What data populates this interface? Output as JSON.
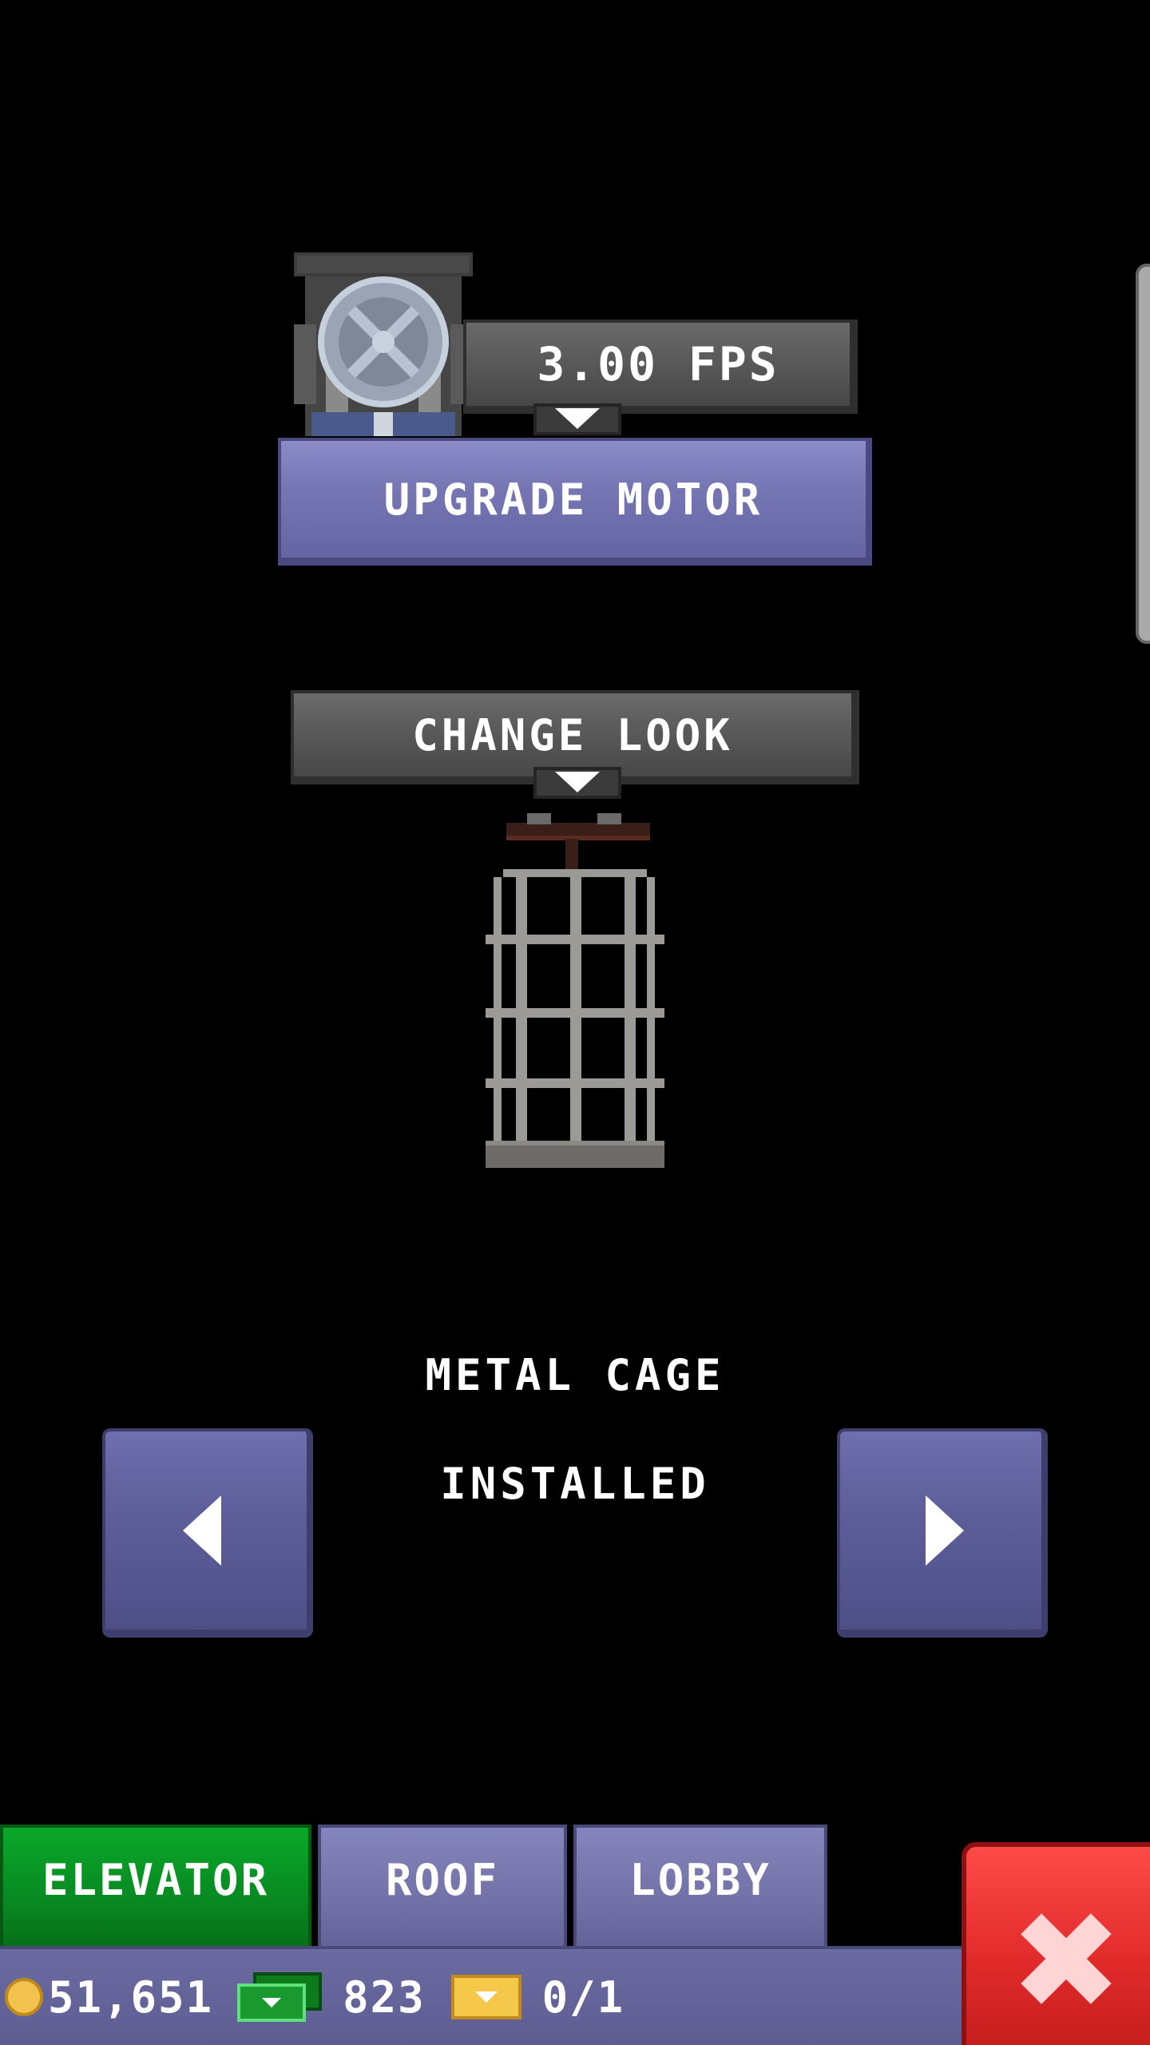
{
  "motor": {
    "speed_label": "3.00 FPS",
    "upgrade_label": "UPGRADE MOTOR"
  },
  "look": {
    "change_label": "CHANGE LOOK",
    "item_name": "METAL CAGE",
    "item_status": "INSTALLED"
  },
  "tabs": [
    {
      "label": "ELEVATOR",
      "active": true
    },
    {
      "label": "ROOF",
      "active": false
    },
    {
      "label": "LOBBY",
      "active": false
    }
  ],
  "status_bar": {
    "coins": "51,651",
    "bux": "823",
    "vip": "0/1"
  },
  "colors": {
    "active_tab": "#088a22",
    "tab": "#7272a8",
    "button": "#7676b4",
    "close": "#e02a2a"
  },
  "icons": {
    "motor": "motor-wheel-icon",
    "cage": "metal-cage-icon",
    "prev": "arrow-left-icon",
    "next": "arrow-right-icon",
    "coin": "coin-icon",
    "bux": "bux-icon",
    "vip": "vip-ticket-icon",
    "close": "close-icon"
  }
}
